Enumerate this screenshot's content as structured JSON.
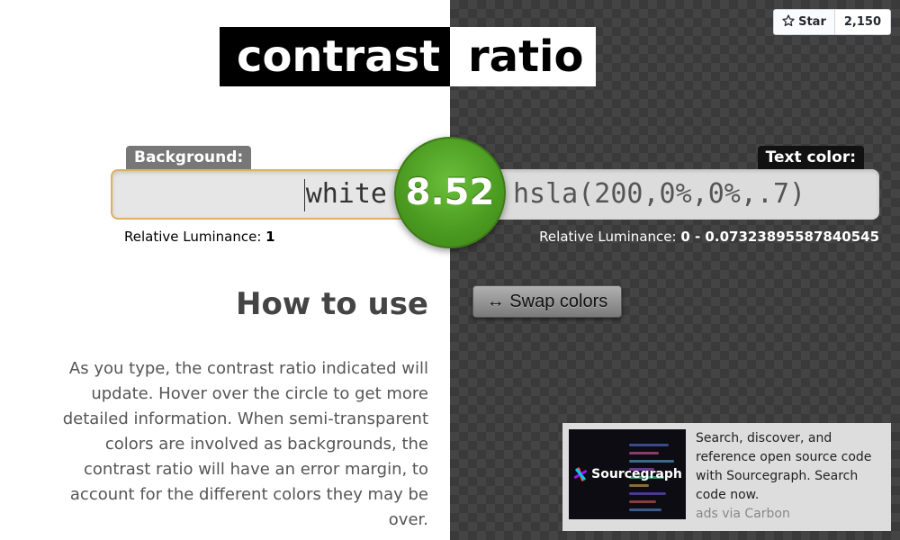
{
  "title": {
    "part1": "contrast",
    "part2": "ratio"
  },
  "github": {
    "star_label": "Star",
    "star_count": "2,150"
  },
  "background": {
    "label": "Background:",
    "value": "white",
    "luminance_label": "Relative Luminance:",
    "luminance_value": "1"
  },
  "foreground": {
    "label": "Text color:",
    "value": "hsla(200,0%,0%,.7)",
    "luminance_label": "Relative Luminance:",
    "luminance_value": "0 - 0.07323895587840545"
  },
  "ratio": {
    "value": "8.52",
    "color": "#4a9a20"
  },
  "swap": {
    "label": "↔ Swap colors"
  },
  "howto": {
    "title": "How to use",
    "text": "As you type, the contrast ratio indicated will update. Hover over the circle to get more detailed information. When semi-transparent colors are involved as backgrounds, the contrast ratio will have an error margin, to account for the different colors they may be over."
  },
  "ad": {
    "brand": "Sourcegraph",
    "text": "Search, discover, and reference open source code with Sourcegraph. Search code now.",
    "via": "ads via Carbon"
  }
}
